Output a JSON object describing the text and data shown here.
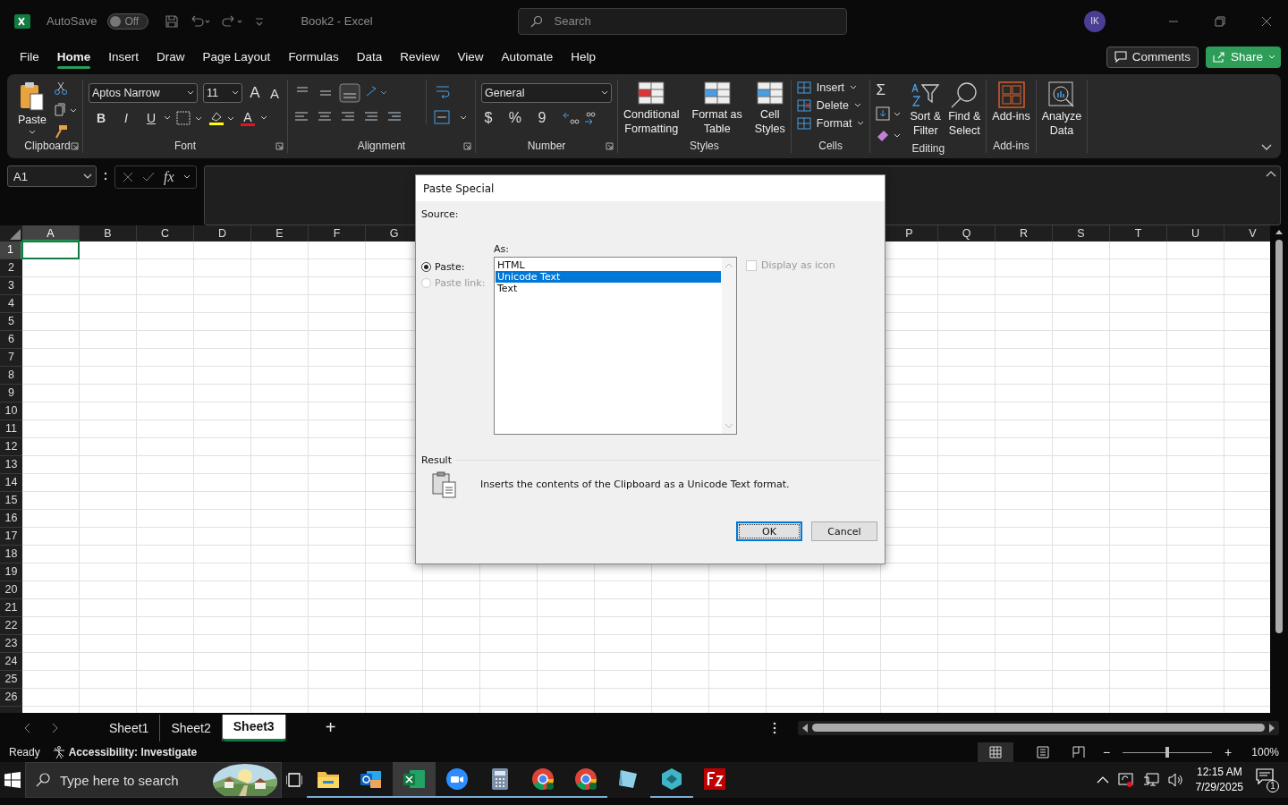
{
  "title_bar": {
    "autosave_label": "AutoSave",
    "autosave": {
      "on": false,
      "label": "Off"
    },
    "document_title": "Book2  -  Excel",
    "search": {
      "placeholder": "Search"
    },
    "avatar": "IK"
  },
  "menu_tabs": [
    {
      "label": "File",
      "selected": false
    },
    {
      "label": "Home",
      "selected": true
    },
    {
      "label": "Insert",
      "selected": false
    },
    {
      "label": "Draw",
      "selected": false
    },
    {
      "label": "Page Layout",
      "selected": false
    },
    {
      "label": "Formulas",
      "selected": false
    },
    {
      "label": "Data",
      "selected": false
    },
    {
      "label": "Review",
      "selected": false
    },
    {
      "label": "View",
      "selected": false
    },
    {
      "label": "Automate",
      "selected": false
    },
    {
      "label": "Help",
      "selected": false
    }
  ],
  "header_buttons": {
    "comments": "Comments",
    "share": "Share"
  },
  "ribbon": {
    "groups": [
      {
        "kind": "clipboard",
        "name": "Clipboard",
        "launcher": true,
        "paste": "Paste"
      },
      {
        "kind": "font",
        "name": "Font",
        "launcher": true,
        "font_name": "Aptos Narrow",
        "font_size": "11",
        "grow": "A",
        "shrink": "A",
        "styles": [
          "B",
          "I",
          "U"
        ],
        "color_letter": "A"
      },
      {
        "kind": "alignment",
        "name": "Alignment",
        "launcher": true
      },
      {
        "kind": "number",
        "name": "Number",
        "launcher": true,
        "format": "General",
        "symbols": [
          "$",
          "%",
          "9"
        ]
      },
      {
        "kind": "styles",
        "name": "Styles",
        "buttons": [
          {
            "line1": "Conditional",
            "line2": "Formatting"
          },
          {
            "line1": "Format as",
            "line2": "Table"
          },
          {
            "line1": "Cell",
            "line2": "Styles"
          }
        ]
      },
      {
        "kind": "cells",
        "name": "Cells",
        "buttons": [
          "Insert",
          "Delete",
          "Format"
        ]
      },
      {
        "kind": "editing",
        "name": "Editing",
        "sum": "Σ",
        "buttons": [
          {
            "line1": "Sort &",
            "line2": "Filter"
          },
          {
            "line1": "Find &",
            "line2": "Select"
          }
        ]
      },
      {
        "kind": "addins",
        "name": "Add-ins",
        "button": "Add-ins"
      },
      {
        "kind": "analyze",
        "line1": "Analyze",
        "line2": "Data"
      }
    ]
  },
  "formula_bar": {
    "name_box": "A1",
    "fx": "fx"
  },
  "grid": {
    "columns_left": [
      {
        "label": "A",
        "selected": true
      },
      {
        "label": "B",
        "selected": false
      },
      {
        "label": "C",
        "selected": false
      },
      {
        "label": "D",
        "selected": false
      },
      {
        "label": "E",
        "selected": false
      },
      {
        "label": "F",
        "selected": false
      },
      {
        "label": "G",
        "selected": false
      }
    ],
    "columns_right": [
      {
        "label": "P",
        "selected": false
      },
      {
        "label": "Q",
        "selected": false
      },
      {
        "label": "R",
        "selected": false
      },
      {
        "label": "S",
        "selected": false
      },
      {
        "label": "T",
        "selected": false
      },
      {
        "label": "U",
        "selected": false
      },
      {
        "label": "V",
        "selected": false
      }
    ],
    "rows": [
      {
        "label": "1",
        "selected": true
      },
      {
        "label": "2",
        "selected": false
      },
      {
        "label": "3",
        "selected": false
      },
      {
        "label": "4",
        "selected": false
      },
      {
        "label": "5",
        "selected": false
      },
      {
        "label": "6",
        "selected": false
      },
      {
        "label": "7",
        "selected": false
      },
      {
        "label": "8",
        "selected": false
      },
      {
        "label": "9",
        "selected": false
      },
      {
        "label": "10",
        "selected": false
      },
      {
        "label": "11",
        "selected": false
      },
      {
        "label": "12",
        "selected": false
      },
      {
        "label": "13",
        "selected": false
      },
      {
        "label": "14",
        "selected": false
      },
      {
        "label": "15",
        "selected": false
      },
      {
        "label": "16",
        "selected": false
      },
      {
        "label": "17",
        "selected": false
      },
      {
        "label": "18",
        "selected": false
      },
      {
        "label": "19",
        "selected": false
      },
      {
        "label": "20",
        "selected": false
      },
      {
        "label": "21",
        "selected": false
      },
      {
        "label": "22",
        "selected": false
      },
      {
        "label": "23",
        "selected": false
      },
      {
        "label": "24",
        "selected": false
      },
      {
        "label": "25",
        "selected": false
      },
      {
        "label": "26",
        "selected": false
      }
    ]
  },
  "dialog": {
    "title": "Paste Special",
    "source_label": "Source:",
    "as_label": "As:",
    "radios": [
      {
        "label": "Paste:",
        "selected": true,
        "disabled": false
      },
      {
        "label": "Paste link:",
        "selected": false,
        "disabled": true
      }
    ],
    "formats": [
      {
        "label": "HTML",
        "selected": false
      },
      {
        "label": "Unicode Text",
        "selected": true
      },
      {
        "label": "Text",
        "selected": false
      }
    ],
    "display_as_icon": {
      "label": "Display as icon",
      "checked": false,
      "disabled": true
    },
    "result_label": "Result",
    "result_text": "Inserts the contents of the Clipboard as a Unicode Text format.",
    "ok": "OK",
    "cancel": "Cancel"
  },
  "sheet_tabs": [
    {
      "label": "Sheet1",
      "selected": false
    },
    {
      "label": "Sheet2",
      "selected": false
    },
    {
      "label": "Sheet3",
      "selected": true
    }
  ],
  "add_sheet": "+",
  "status_bar": {
    "ready": "Ready",
    "accessibility": "Accessibility: Investigate",
    "zoom": {
      "level": 0.5
    },
    "zoom_percent": "100%",
    "minus": "−",
    "plus": "+"
  },
  "taskbar": {
    "search": {
      "placeholder": "Type here to search"
    },
    "apps": [
      {
        "kind": "folder",
        "running": true,
        "active": false
      },
      {
        "kind": "mail",
        "running": true,
        "active": false
      },
      {
        "kind": "sheet",
        "running": true,
        "active": true
      },
      {
        "kind": "zoom",
        "running": true,
        "active": false
      },
      {
        "kind": "calculator",
        "running": true,
        "active": false
      },
      {
        "kind": "browser",
        "running": true,
        "active": false
      },
      {
        "kind": "browser",
        "running": true,
        "active": false
      },
      {
        "kind": "notepad",
        "running": false,
        "active": false
      },
      {
        "kind": "cube",
        "running": true,
        "active": false
      },
      {
        "kind": "ftp",
        "running": false,
        "active": false
      }
    ],
    "time": "12:15 AM",
    "date": "7/29/2025",
    "notifications": "1"
  }
}
